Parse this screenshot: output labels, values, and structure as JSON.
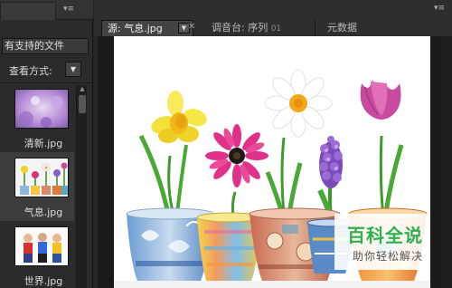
{
  "left_panel": {
    "menu_icon": "panel-menu-icon",
    "filter_label": "有支持的文件",
    "view_label": "查看方式:",
    "view_button_icon": "dropdown-arrow-icon",
    "items": [
      {
        "label": "清新.jpg",
        "selected": false
      },
      {
        "label": "气息.jpg",
        "selected": true
      },
      {
        "label": "世界.jpg",
        "selected": false
      }
    ]
  },
  "right_panel": {
    "tabs": [
      {
        "label": "源: 气息.jpg",
        "active": true
      },
      {
        "label": "调音台: 序列",
        "number": "01",
        "active": false
      },
      {
        "label": "元数据",
        "active": false
      }
    ],
    "close_icon": "close-icon",
    "menu_icon": "panel-menu-icon"
  },
  "watermark": {
    "title": "百科全说",
    "subtitle": "助你轻松解决"
  },
  "colors": {
    "panel_bg": "#2b2b2b",
    "active_tab": "#434343",
    "canvas_bg": "#ffffff",
    "watermark_green": "#2fb04e"
  }
}
